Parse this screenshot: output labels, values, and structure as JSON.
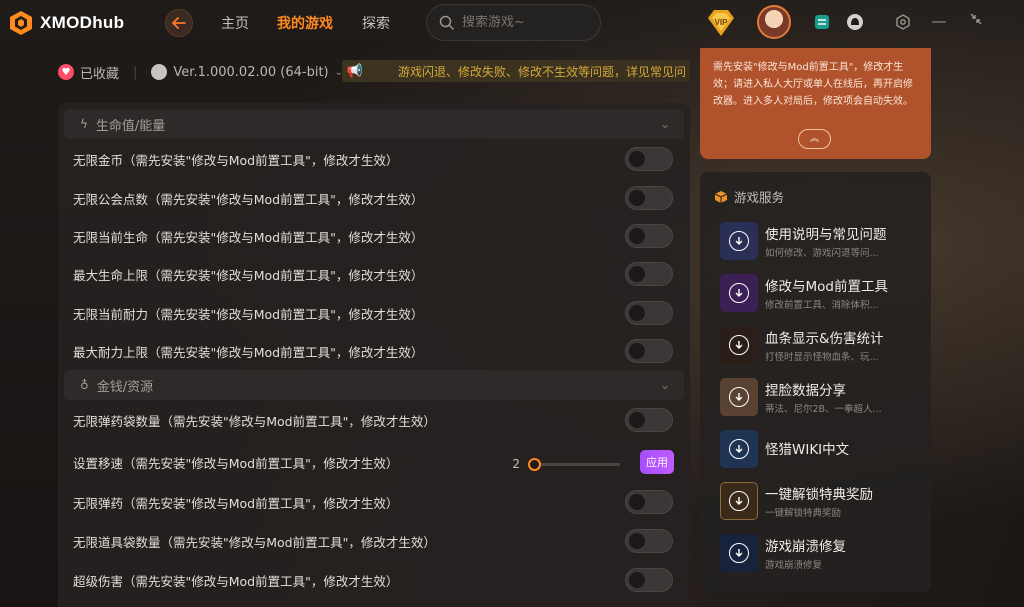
{
  "app": {
    "name": "XMODhub",
    "brand_color": "#ff8a1f"
  },
  "nav": {
    "items": [
      {
        "label": "主页",
        "active": false
      },
      {
        "label": "我的游戏",
        "active": true
      },
      {
        "label": "探索",
        "active": false
      }
    ]
  },
  "search": {
    "placeholder": "搜索游戏~"
  },
  "topbar_icons": [
    "vip-icon",
    "avatar",
    "chat-icon",
    "bell-icon",
    "settings-icon",
    "minimize-icon",
    "shrink-icon"
  ],
  "info": {
    "favorited_label": "已收藏",
    "separator": "|",
    "version": "Ver.1.000.02.00 (64-bit)",
    "notice": "游戏闪退、修改失败、修改不生效等问题，详见常见问"
  },
  "sections": [
    {
      "title": "生命值/能量",
      "icon": "lightning-icon",
      "rows": [
        {
          "label": "无限金币（需先安装\"修改与Mod前置工具\"，修改才生效）",
          "control": "toggle",
          "on": false
        },
        {
          "label": "无限公会点数（需先安装\"修改与Mod前置工具\"，修改才生效）",
          "control": "toggle",
          "on": false
        },
        {
          "label": "无限当前生命（需先安装\"修改与Mod前置工具\"，修改才生效）",
          "control": "toggle",
          "on": false
        },
        {
          "label": "最大生命上限（需先安装\"修改与Mod前置工具\"，修改才生效）",
          "control": "toggle",
          "on": false
        },
        {
          "label": "无限当前耐力（需先安装\"修改与Mod前置工具\"，修改才生效）",
          "control": "toggle",
          "on": false
        },
        {
          "label": "最大耐力上限（需先安装\"修改与Mod前置工具\"，修改才生效）",
          "control": "toggle",
          "on": false
        }
      ]
    },
    {
      "title": "金钱/资源",
      "icon": "money-bag-icon",
      "rows": [
        {
          "label": "无限弹药袋数量（需先安装\"修改与Mod前置工具\"，修改才生效）",
          "control": "toggle",
          "on": false
        },
        {
          "label": "设置移速（需先安装\"修改与Mod前置工具\"，修改才生效）",
          "control": "slider",
          "value": "2",
          "fraction": 0.0,
          "apply_label": "应用"
        },
        {
          "label": "无限弹药（需先安装\"修改与Mod前置工具\"，修改才生效）",
          "control": "toggle",
          "on": false
        },
        {
          "label": "无限道具袋数量（需先安装\"修改与Mod前置工具\"，修改才生效）",
          "control": "toggle",
          "on": false
        },
        {
          "label": "超级伤害（需先安装\"修改与Mod前置工具\"，修改才生效）",
          "control": "toggle",
          "on": false
        }
      ]
    }
  ],
  "tip_card": {
    "text": "需先安装\"修改与Mod前置工具\"，修改才生效；请进入私人大厅或单人在线后，再开启修改器。进入多人对局后，修改项会自动失效。",
    "bg_color": "#b0522b"
  },
  "services": {
    "title": "游戏服务",
    "items": [
      {
        "title": "使用说明与常见问题",
        "subtitle": "如何修改、游戏闪退等问...",
        "thumb_color": "#2a2f55"
      },
      {
        "title": "修改与Mod前置工具",
        "subtitle": "修改前置工具、消除体积...",
        "thumb_color": "#3b1f55"
      },
      {
        "title": "血条显示&伤害统计",
        "subtitle": "打怪时显示怪物血条、玩...",
        "thumb_color": "#2a1e18"
      },
      {
        "title": "捏脸数据分享",
        "subtitle": "蒂法、尼尔2B、一拳超人...",
        "thumb_color": "#5a4232"
      },
      {
        "title": "怪猎WIKI中文",
        "subtitle": "",
        "thumb_color": "#1f3352"
      },
      {
        "title": "一键解锁特典奖励",
        "subtitle": "一键解锁特典奖励",
        "thumb_color": "#3a2a1c"
      },
      {
        "title": "游戏崩溃修复",
        "subtitle": "游戏崩溃修复",
        "thumb_color": "#17233d"
      }
    ]
  }
}
